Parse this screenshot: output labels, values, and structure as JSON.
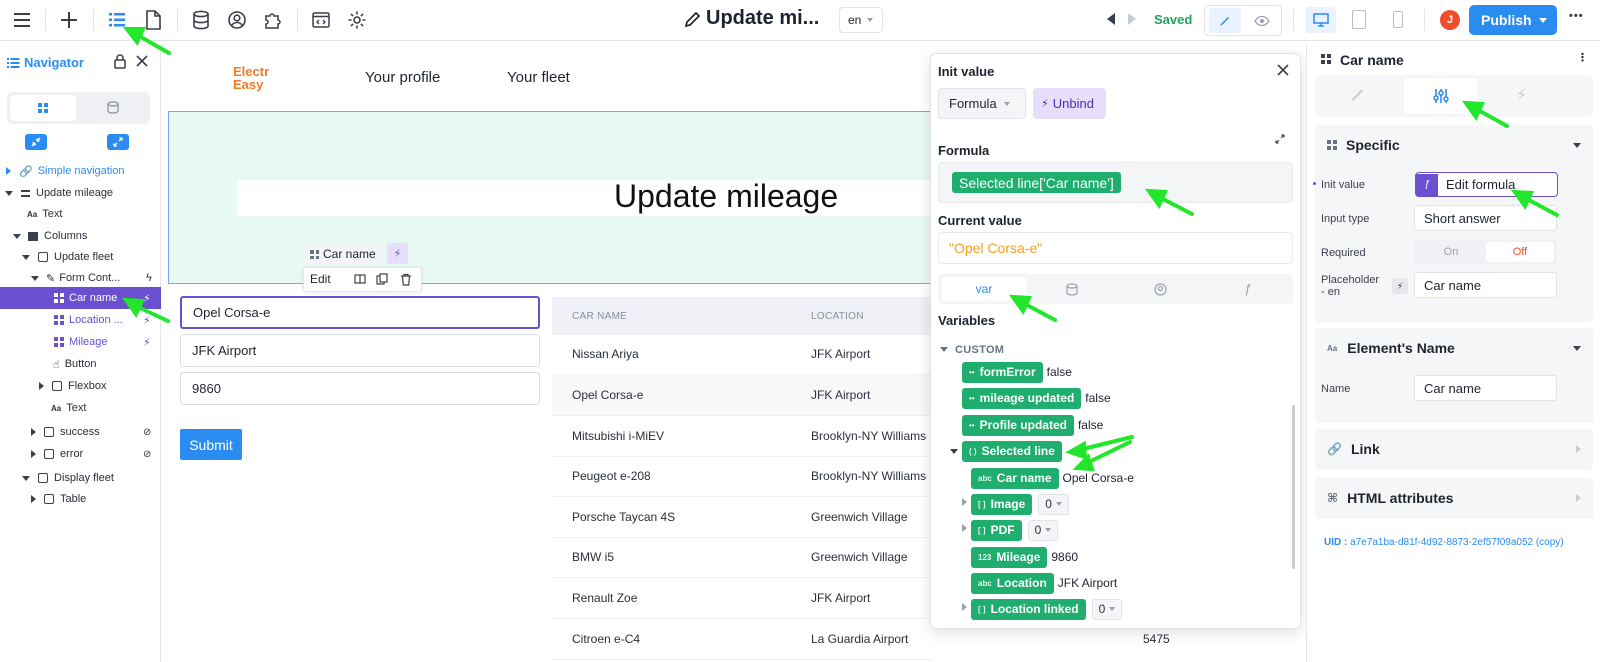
{
  "topbar": {
    "page_title": "Update mi...",
    "lang": "en",
    "saved": "Saved",
    "publish": "Publish",
    "avatar": "J",
    "more": "•••"
  },
  "navigator": {
    "title": "Navigator",
    "items": [
      {
        "label": "Simple navigation"
      },
      {
        "label": "Update mileage"
      },
      {
        "label": "Text"
      },
      {
        "label": "Columns"
      },
      {
        "label": "Update fleet"
      },
      {
        "label": "Form Cont..."
      },
      {
        "label": "Car name"
      },
      {
        "label": "Location ..."
      },
      {
        "label": "Mileage"
      },
      {
        "label": "Button"
      },
      {
        "label": "Flexbox"
      },
      {
        "label": "Text"
      },
      {
        "label": "success"
      },
      {
        "label": "error"
      },
      {
        "label": "Display fleet"
      },
      {
        "label": "Table"
      }
    ]
  },
  "canvas": {
    "logo_line1": "Electr",
    "logo_line2": "Easy",
    "nav_links": [
      "Your profile",
      "Your fleet"
    ],
    "hero_title": "Update mileage",
    "selected_tag": "Car name",
    "toolbar_edit": "Edit",
    "form_values": [
      "Opel Corsa-e",
      "JFK Airport",
      "9860"
    ],
    "submit": "Submit",
    "table": {
      "headers": [
        "CAR NAME",
        "LOCATION"
      ],
      "rows": [
        {
          "car": "Nissan Ariya",
          "location": "JFK Airport",
          "extra": ""
        },
        {
          "car": "Opel Corsa-e",
          "location": "JFK Airport",
          "extra": ""
        },
        {
          "car": "Mitsubishi i-MiEV",
          "location": "Brooklyn-NY Williams",
          "extra": ""
        },
        {
          "car": "Peugeot e-208",
          "location": "Brooklyn-NY Williams",
          "extra": ""
        },
        {
          "car": "Porsche Taycan 4S",
          "location": "Greenwich Village",
          "extra": ""
        },
        {
          "car": "BMW i5",
          "location": "Greenwich Village",
          "extra": ""
        },
        {
          "car": "Renault Zoe",
          "location": "JFK Airport",
          "extra": ""
        },
        {
          "car": "Citroen e-C4",
          "location": "La Guardia Airport",
          "extra": "5475"
        }
      ]
    }
  },
  "popup": {
    "init_value": "Init value",
    "formula_select": "Formula",
    "unbind": "Unbind",
    "formula_label": "Formula",
    "formula_chip": "Selected line['Car name']",
    "current_value_label": "Current value",
    "current_value": "\"Opel Corsa-e\"",
    "tab_var": "var",
    "variables_label": "Variables",
    "custom_label": "CUSTOM",
    "vars": [
      {
        "tag": "••",
        "name": "formError",
        "value": "false"
      },
      {
        "tag": "••",
        "name": "mileage updated",
        "value": "false"
      },
      {
        "tag": "••",
        "name": "Profile updated",
        "value": "false"
      },
      {
        "tag": "( )",
        "name": "Selected line",
        "value": ""
      },
      {
        "tag": "abc",
        "name": "Car name",
        "value": "Opel Corsa-e"
      },
      {
        "tag": "[ ]",
        "name": "Image",
        "value": "0"
      },
      {
        "tag": "[ ]",
        "name": "PDF",
        "value": "0"
      },
      {
        "tag": "123",
        "name": "Mileage",
        "value": "9860"
      },
      {
        "tag": "abc",
        "name": "Location",
        "value": "JFK Airport"
      },
      {
        "tag": "[ ]",
        "name": "Location linked",
        "value": "0"
      }
    ]
  },
  "rightpanel": {
    "element_title": "Car name",
    "specific": "Specific",
    "init_value_label": "Init value",
    "edit_formula": "Edit formula",
    "input_type_label": "Input type",
    "input_type_value": "Short answer",
    "required_label": "Required",
    "required_on": "On",
    "required_off": "Off",
    "placeholder_label": "Placeholder - en",
    "placeholder_value": "Car name",
    "element_name_section": "Element's Name",
    "name_label": "Name",
    "name_value": "Car name",
    "link_section": "Link",
    "html_attrs_section": "HTML attributes",
    "uid_label": "UID :",
    "uid_value": "a7e7a1ba-d81f-4d92-8873-2ef57f09a052 (copy)"
  },
  "colors": {
    "accent_blue": "#3b8ff0",
    "publish_blue": "#2a8cf0",
    "selected_purple": "#6a4fd1",
    "var_green": "#1fae6e",
    "saved_green": "#22a35a",
    "annotation_arrow": "#22e62a",
    "logo_orange": "#f07b2b"
  }
}
